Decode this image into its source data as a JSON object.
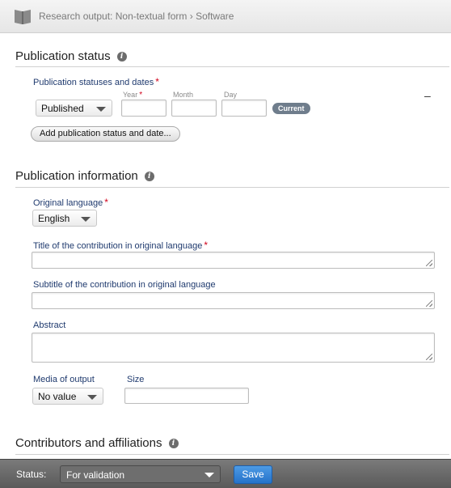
{
  "header": {
    "breadcrumb": "Research output: Non-textual form › Software",
    "icon": "book-icon"
  },
  "publication_status": {
    "title": "Publication status",
    "statuses_label": "Publication statuses and dates",
    "status_value": "Published",
    "year_label": "Year",
    "month_label": "Month",
    "day_label": "Day",
    "year_value": "",
    "month_value": "",
    "day_value": "",
    "current_badge": "Current",
    "remove_symbol": "–",
    "add_button": "Add publication status and date..."
  },
  "publication_information": {
    "title": "Publication information",
    "original_language_label": "Original language",
    "original_language_value": "English",
    "title_label": "Title of the contribution in original language",
    "title_value": "",
    "subtitle_label": "Subtitle of the contribution in original language",
    "subtitle_value": "",
    "abstract_label": "Abstract",
    "abstract_value": "",
    "media_label": "Media of output",
    "media_value": "No value",
    "size_label": "Size",
    "size_value": ""
  },
  "contributors": {
    "title": "Contributors and affiliations"
  },
  "footer": {
    "status_label": "Status:",
    "status_value": "For validation",
    "save_label": "Save"
  },
  "colors": {
    "label_blue": "#1f3a6e",
    "required_red": "#d0021b",
    "save_blue": "#2572c9",
    "footer_gray": "#6a6a6a"
  }
}
